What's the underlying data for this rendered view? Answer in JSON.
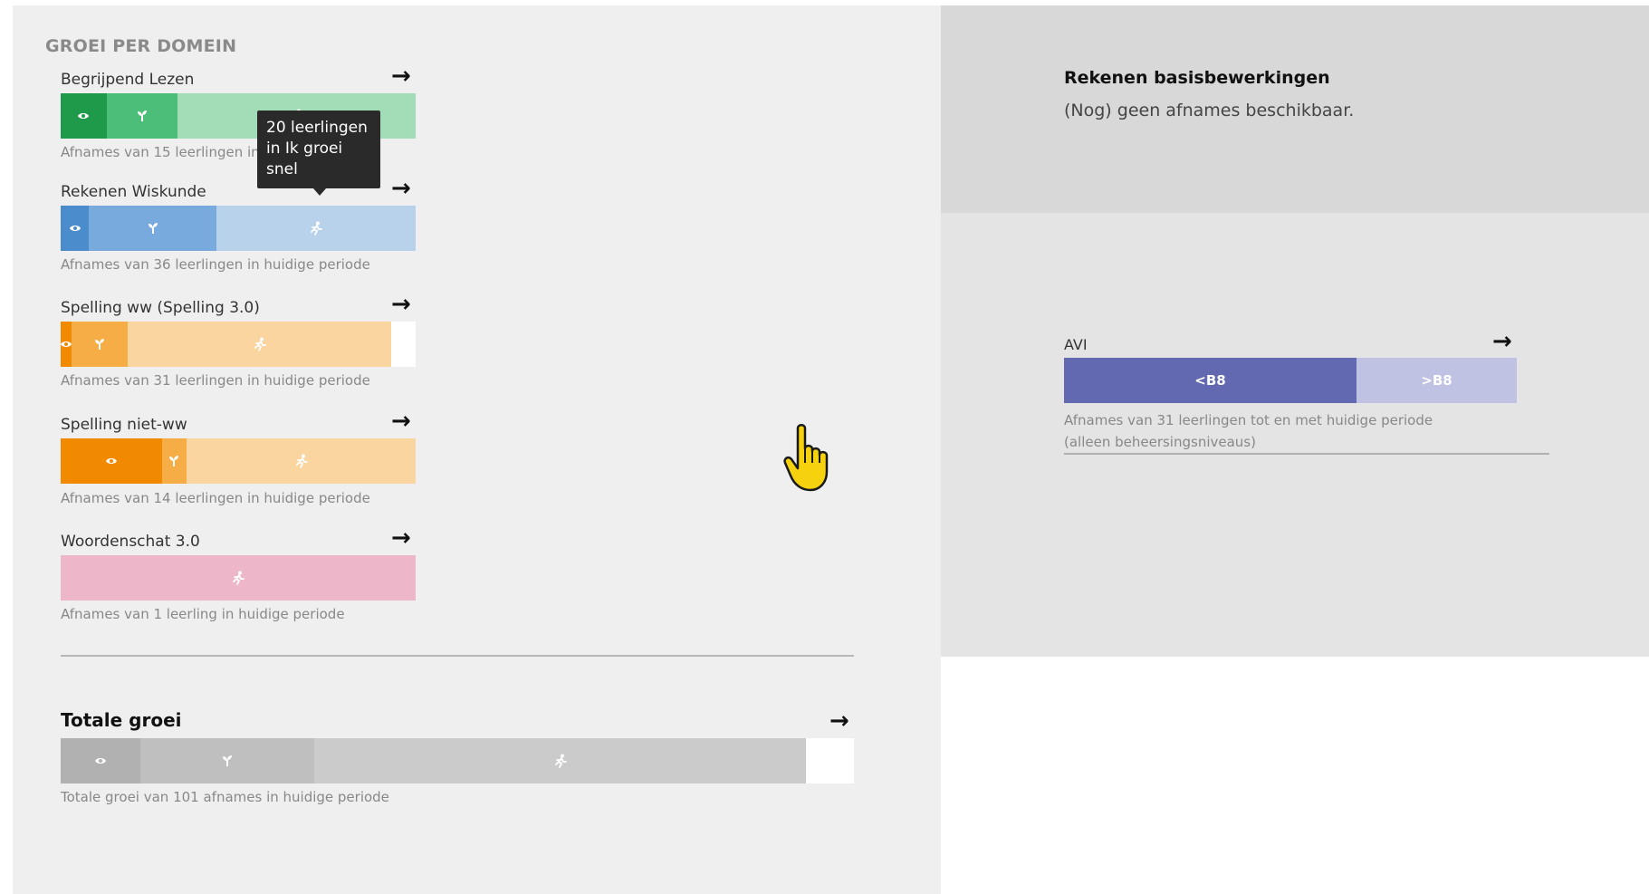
{
  "section_title": "GROEI PER DOMEIN",
  "domains": [
    {
      "label": "Begrijpend Lezen",
      "note": "Afnames van 15 leerlingen in huidige periode",
      "segments": [
        {
          "icon": "eye-icon",
          "share": 0.13,
          "color": "#1f9a4a"
        },
        {
          "icon": "sprout-icon",
          "share": 0.2,
          "color": "#4dbd7a"
        },
        {
          "icon": "runner-icon",
          "share": 0.67,
          "color": "#a3ddb8"
        }
      ]
    },
    {
      "label": "Rekenen Wiskunde",
      "note": "Afnames van 36 leerlingen in huidige periode",
      "segments": [
        {
          "icon": "eye-icon",
          "share": 0.08,
          "color": "#4a8ccc"
        },
        {
          "icon": "sprout-icon",
          "share": 0.36,
          "color": "#78aade"
        },
        {
          "icon": "runner-icon",
          "share": 0.56,
          "color": "#b9d2ec"
        }
      ]
    },
    {
      "label": "Spelling ww (Spelling 3.0)",
      "note": "Afnames van 31 leerlingen in huidige periode",
      "segments": [
        {
          "icon": "eye-icon",
          "share": 0.03,
          "color": "#f28a00"
        },
        {
          "icon": "sprout-icon",
          "share": 0.16,
          "color": "#f7ad45"
        },
        {
          "icon": "runner-icon",
          "share": 0.74,
          "color": "#fbd5a0"
        },
        {
          "icon": "",
          "share": 0.07,
          "color": "#ffffff"
        }
      ]
    },
    {
      "label": "Spelling niet-ww",
      "note": "Afnames van 14 leerlingen in huidige periode",
      "segments": [
        {
          "icon": "eye-icon",
          "share": 0.285,
          "color": "#f28a00"
        },
        {
          "icon": "sprout-icon",
          "share": 0.07,
          "color": "#f7ad45"
        },
        {
          "icon": "runner-icon",
          "share": 0.645,
          "color": "#fbd5a0"
        }
      ]
    },
    {
      "label": "Woordenschat 3.0",
      "note": "Afnames van 1 leerling in huidige periode",
      "segments": [
        {
          "icon": "runner-icon",
          "share": 1.0,
          "color": "#edb7c9"
        }
      ]
    }
  ],
  "tooltip": "20 leerlingen in Ik groei snel",
  "total": {
    "title": "Totale groei",
    "note": "Totale groei van 101 afnames in huidige periode",
    "segments": [
      {
        "icon": "eye-icon",
        "share": 0.1,
        "color": "#b1b1b1"
      },
      {
        "icon": "sprout-icon",
        "share": 0.22,
        "color": "#bfbfbf"
      },
      {
        "icon": "runner-icon",
        "share": 0.62,
        "color": "#cbcbcb"
      },
      {
        "icon": "",
        "share": 0.06,
        "color": "#ffffff"
      }
    ]
  },
  "rekenen_basis": {
    "title": "Rekenen basisbewerkingen",
    "subtitle": "(Nog) geen afnames beschikbaar."
  },
  "avi": {
    "label": "AVI",
    "segments": [
      {
        "label": "<B8",
        "share": 0.646,
        "color": "#6369b0"
      },
      {
        "label": ">B8",
        "share": 0.354,
        "color": "#bfc2e2"
      }
    ],
    "note_line1": "Afnames van 31 leerlingen tot en met huidige periode",
    "note_line2": "(alleen beheersingsniveaus)"
  },
  "colors": {
    "left_background": "#efefef",
    "right_top_background": "#d8d8d8",
    "right_mid_background": "#e4e4e4"
  }
}
